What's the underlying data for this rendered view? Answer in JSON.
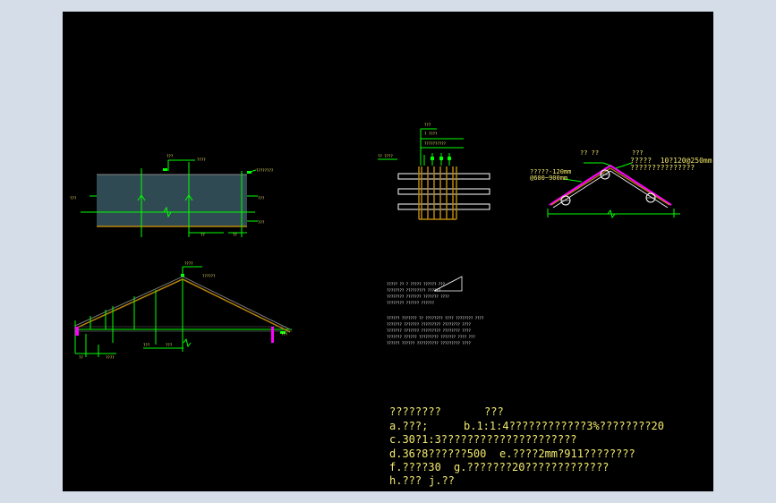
{
  "notes": {
    "title_left": "????????",
    "title_right": "???",
    "line_a_left": "a.???;",
    "line_a_right": "b.1:1:4????????????3%????????20",
    "line_c": "c.30?1:3?????????????????????",
    "line_d_left": "d.36?8??????500",
    "line_d_right": "e.????2mm?911????????",
    "line_f_left": "f.????30",
    "line_f_right": "g.???????20?????????????",
    "line_h_left": "h.???",
    "line_h_right": "j.??"
  },
  "roof_detail": {
    "label_top_left": "?? ??",
    "label_top_right": "???",
    "spec_line1": "?????  10?120@250mm",
    "spec_line2": "???????????????",
    "spacing_label1": "?????-120mm",
    "spacing_label2": "@600~900mm"
  },
  "colors": {
    "background": "#d4dde8",
    "canvas": "#000000",
    "line_green": "#00ff00",
    "line_white": "#ffffff",
    "text_yellow": "#f3ea6d",
    "roof_magenta": "#ff00ff",
    "wall_fill": "#2f4a52",
    "roof_brown": "#b8860b"
  }
}
